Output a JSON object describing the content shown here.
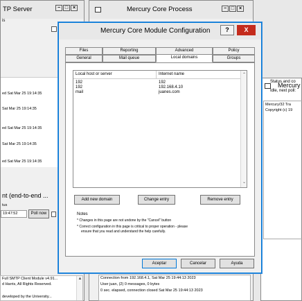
{
  "smtp_window": {
    "title": "TP Server",
    "subtitle": "is",
    "log": [
      "ed Sat Mar 25 19:14:35",
      "Sat Mar 25 19:14:35",
      "ed Sat Mar 25 19:14:35",
      "Sat Mar 25 19:14:35",
      "ed Sat Mar 25 19:14:35"
    ],
    "status_heading": "nt (end-to-end ...",
    "status_label": "tus",
    "status_time": "19:47:52",
    "poll_button": "Poll now"
  },
  "bottom_left": {
    "lines": [
      "Full SMTP Client Module v4.91...",
      "d Harris, All Rights Reserved.",
      "",
      "developed by the University..."
    ]
  },
  "core_process": {
    "title": "Mercury Core Process",
    "log_lines": [
      "Connection from 192.168.4.1, Sat Mar 25 19:44:13 2023",
      "User juan, (2) 0 messages, 0 bytes",
      "0 sec. elapsed, connection closed Sat Mar 25 19:44:13 2023"
    ]
  },
  "right_panel": {
    "title": "Mercury",
    "status_line_1": "Status and co",
    "status_line_2": "Idle, next poll:",
    "info_line_1": "Mercury/32 Tra",
    "info_line_2": "Copyright (c) 19"
  },
  "dialog": {
    "title": "Mercury Core Module Configuration",
    "help_label": "?",
    "close_label": "X",
    "tabs_row1": [
      "Files",
      "Reporting",
      "Advanced",
      "Policy"
    ],
    "tabs_row2": [
      "General",
      "Mail queue",
      "Local domains",
      "Groups"
    ],
    "active_tab": "Local domains",
    "list_headers": [
      "Local host or server",
      "Internet name"
    ],
    "domains": [
      {
        "host": "192",
        "internet": "192"
      },
      {
        "host": "192",
        "internet": "192.168.4.10"
      },
      {
        "host": "mail",
        "internet": "juanes.com"
      }
    ],
    "add_button": "Add new domain",
    "change_button": "Change entry",
    "remove_button": "Remove entry",
    "notes_title": "Notes",
    "notes": [
      "* Changes in this page are not undone by the \"Cancel\" button",
      "* Correct configuration in this page is critical to proper operation - please",
      "ensure that you read and understand the help carefully."
    ],
    "ok_button": "Aceptar",
    "cancel_button": "Cancelar",
    "help_button": "Ayuda"
  }
}
